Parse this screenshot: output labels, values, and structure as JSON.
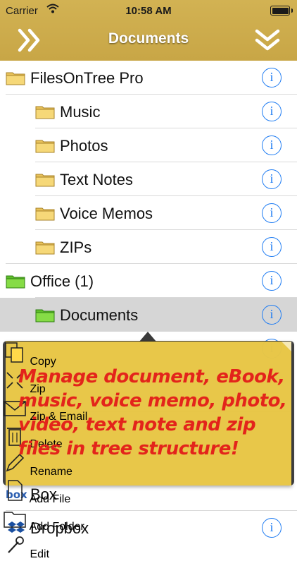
{
  "status_bar": {
    "carrier": "Carrier",
    "time": "10:58 AM"
  },
  "nav": {
    "title": "Documents",
    "left_icon": "double-chevron-right-icon",
    "right_icon": "double-chevron-down-icon"
  },
  "tree": {
    "rows": [
      {
        "label": "FilesOnTree Pro",
        "level": 0,
        "icon": "yellow-folder-icon"
      },
      {
        "label": "Music",
        "level": 1,
        "icon": "yellow-folder-icon"
      },
      {
        "label": "Photos",
        "level": 1,
        "icon": "yellow-folder-icon"
      },
      {
        "label": "Text Notes",
        "level": 1,
        "icon": "yellow-folder-icon"
      },
      {
        "label": "Voice Memos",
        "level": 1,
        "icon": "yellow-folder-icon"
      },
      {
        "label": "ZIPs",
        "level": 1,
        "icon": "yellow-folder-icon"
      },
      {
        "label": "Office (1)",
        "level": 0,
        "icon": "green-folder-icon"
      },
      {
        "label": "Documents",
        "level": 1,
        "icon": "green-folder-icon",
        "selected": true
      }
    ],
    "cloud_rows": [
      {
        "label": "Box",
        "icon": "box-logo-icon",
        "logo_text": "box"
      },
      {
        "label": "Dropbox",
        "icon": "dropbox-logo-icon"
      }
    ]
  },
  "popup": {
    "actions": [
      {
        "label": "Copy",
        "icon": "copy-icon"
      },
      {
        "label": "Zip",
        "icon": "zip-icon"
      },
      {
        "label": "Zip & Email",
        "icon": "envelope-icon"
      },
      {
        "label": "Delete",
        "icon": "trash-icon"
      },
      {
        "label": "Rename",
        "icon": "pencil-icon"
      },
      {
        "label": "Add File",
        "icon": "add-file-icon"
      },
      {
        "label": "Add Folder",
        "icon": "add-folder-icon"
      },
      {
        "label": "Edit",
        "icon": "wrench-icon"
      }
    ]
  },
  "note": {
    "text": "Manage document, eBook, music, voice memo, photo, video, text note and zip files in tree structure!"
  },
  "colors": {
    "header": "#cdac4c",
    "info_blue": "#1f7cf2",
    "note_yellow": "#ffd94a",
    "note_text": "#e3241b",
    "selected_row": "#d6d6d6"
  }
}
